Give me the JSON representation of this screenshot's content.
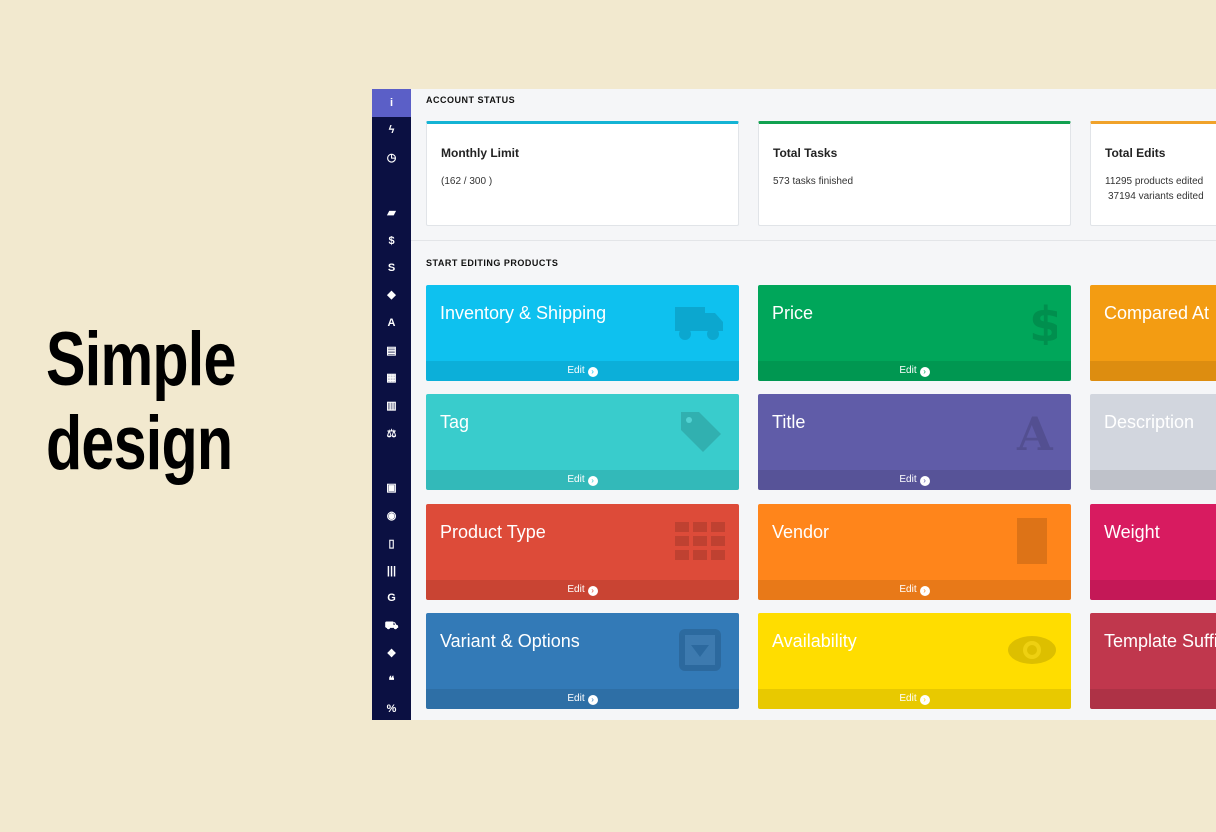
{
  "headline": [
    "Simple",
    "design"
  ],
  "sidebar": {
    "icons": [
      {
        "name": "info-icon",
        "glyph": "i"
      },
      {
        "name": "bolt-icon",
        "glyph": "ϟ"
      },
      {
        "name": "clock-icon",
        "glyph": "◷"
      },
      {
        "name": "truck-icon",
        "glyph": "▰"
      },
      {
        "name": "dollar-icon",
        "glyph": "$"
      },
      {
        "name": "strikethrough-icon",
        "glyph": "S"
      },
      {
        "name": "tag-icon",
        "glyph": "◆"
      },
      {
        "name": "font-icon",
        "glyph": "A"
      },
      {
        "name": "file-code-icon",
        "glyph": "▤"
      },
      {
        "name": "grid-icon",
        "glyph": "▦"
      },
      {
        "name": "building-icon",
        "glyph": "▥"
      },
      {
        "name": "balance-scale-icon",
        "glyph": "⚖"
      },
      {
        "name": "caret-square-down-icon",
        "glyph": "▣"
      },
      {
        "name": "eye-icon",
        "glyph": "◉"
      },
      {
        "name": "file-text-icon",
        "glyph": "▯"
      },
      {
        "name": "barcode-icon",
        "glyph": "|||"
      },
      {
        "name": "google-icon",
        "glyph": "G"
      },
      {
        "name": "cart-icon",
        "glyph": "⛟"
      },
      {
        "name": "cubes-icon",
        "glyph": "❖"
      },
      {
        "name": "quote-icon",
        "glyph": "❝"
      },
      {
        "name": "percent-icon",
        "glyph": "%"
      }
    ]
  },
  "account_status": {
    "title": "ACCOUNT STATUS",
    "cards": [
      {
        "title": "Monthly Limit",
        "lines": [
          "(162 / 300 )"
        ],
        "accent": "#14b3d4"
      },
      {
        "title": "Total Tasks",
        "lines": [
          "573 tasks finished"
        ],
        "accent": "#12a150"
      },
      {
        "title": "Total Edits",
        "lines": [
          "11295 products edited",
          "37194 variants edited"
        ],
        "accent": "#f0a22a"
      }
    ]
  },
  "start_editing": {
    "title": "START EDITING PRODUCTS",
    "edit_label": "Edit",
    "tiles": [
      {
        "label": "Inventory & Shipping",
        "color": "#0ec1ef",
        "icon": "truck-icon"
      },
      {
        "label": "Price",
        "color": "#00a65a",
        "icon": "dollar-icon"
      },
      {
        "label": "Compared At",
        "color": "#f39c12",
        "icon": "strikethrough-icon"
      },
      {
        "label": "Tag",
        "color": "#39cccc",
        "icon": "tag-icon"
      },
      {
        "label": "Title",
        "color": "#605ca8",
        "icon": "font-icon"
      },
      {
        "label": "Description",
        "color": "#d2d6de",
        "icon": "file-code-icon"
      },
      {
        "label": "Product Type",
        "color": "#dd4b39",
        "icon": "grid-icon"
      },
      {
        "label": "Vendor",
        "color": "#ff851b",
        "icon": "building-icon"
      },
      {
        "label": "Weight",
        "color": "#d81b60",
        "icon": "balance-scale-icon"
      },
      {
        "label": "Variant & Options",
        "color": "#337ab7",
        "icon": "caret-square-down-icon"
      },
      {
        "label": "Availability",
        "color": "#ffdd00",
        "icon": "eye-icon"
      },
      {
        "label": "Template Suffix",
        "color": "#c0374d",
        "icon": "file-text-icon"
      }
    ]
  }
}
